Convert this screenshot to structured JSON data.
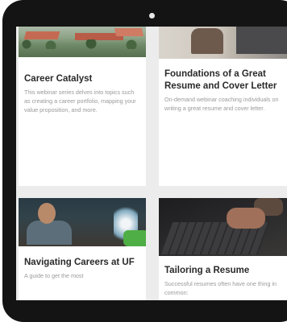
{
  "cards": [
    {
      "title": "Career Catalyst",
      "description": "This webinar series delves into topics such as creating a career portfolio, mapping your value proposition, and more.",
      "image": "aerial-campus-image"
    },
    {
      "title": "Foundations of a Great Resume and Cover Letter",
      "description": "On-demand webinar coaching individuals on writing a great resume and cover letter.",
      "image": "laptop-person-image"
    },
    {
      "title": "Navigating Careers at UF",
      "description": "A guide to get the most",
      "image": "student-laptop-image"
    },
    {
      "title": "Tailoring a Resume",
      "description": "Successful resumes often have one thing in common:",
      "image": "keyboard-hands-image"
    }
  ]
}
